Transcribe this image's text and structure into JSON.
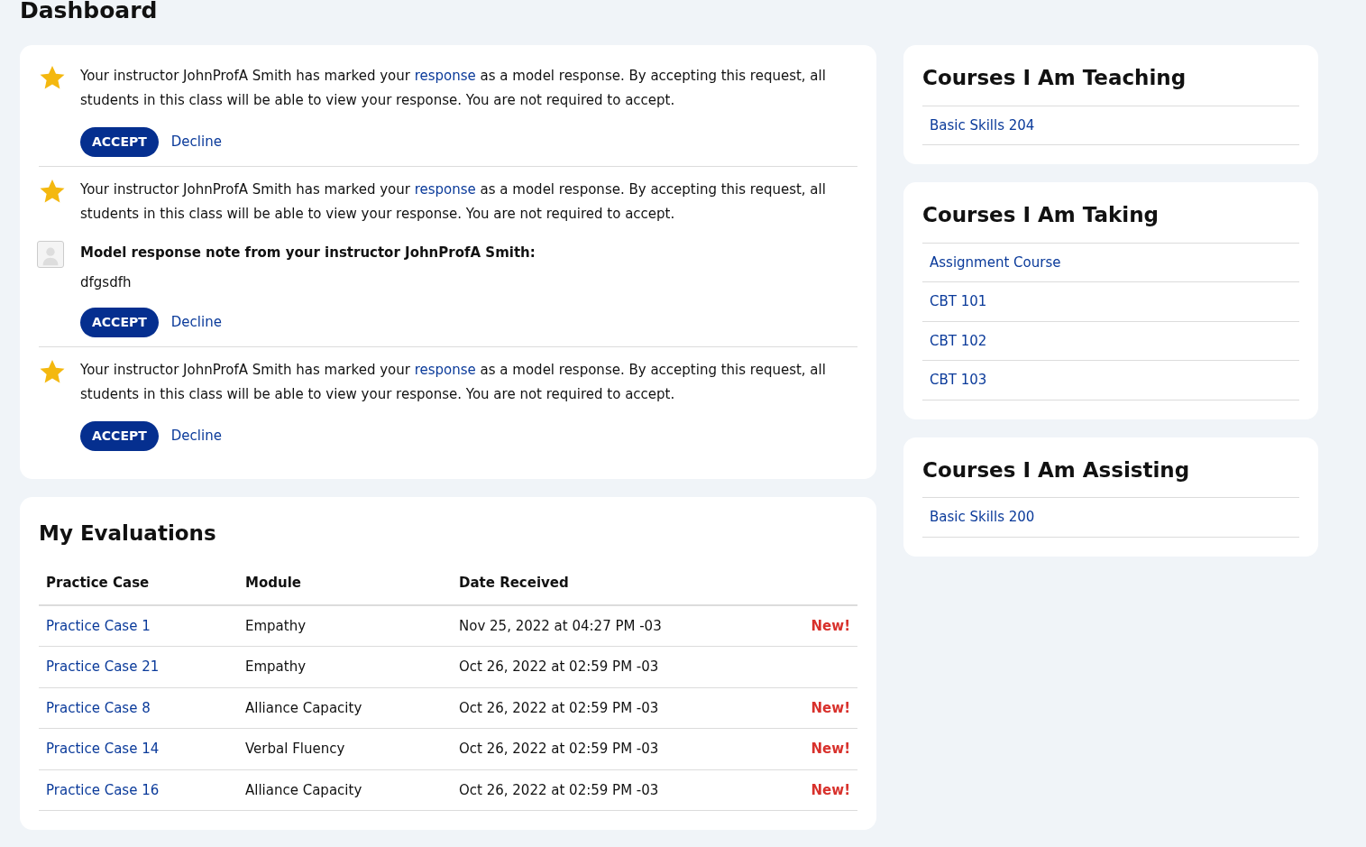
{
  "page_title": "Dashboard",
  "notifications": [
    {
      "text_before": "Your instructor JohnProfA Smith has marked your ",
      "link": "response",
      "text_after": " as a model response. By accepting this request, all students in this class will be able to view your response. You are not required to accept.",
      "accept": "ACCEPT",
      "decline": "Decline"
    },
    {
      "text_before": "Your instructor JohnProfA Smith has marked your ",
      "link": "response",
      "text_after": " as a model response. By accepting this request, all students in this class will be able to view your response. You are not required to accept.",
      "note": {
        "heading": "Model response note from your instructor JohnProfA Smith:",
        "body": "dfgsdfh"
      },
      "accept": "ACCEPT",
      "decline": "Decline"
    },
    {
      "text_before": "Your instructor JohnProfA Smith has marked your ",
      "link": "response",
      "text_after": " as a model response. By accepting this request, all students in this class will be able to view your response. You are not required to accept.",
      "accept": "ACCEPT",
      "decline": "Decline"
    }
  ],
  "evaluations": {
    "title": "My Evaluations",
    "columns": [
      "Practice Case",
      "Module",
      "Date Received"
    ],
    "rows": [
      {
        "case": "Practice Case 1",
        "module": "Empathy",
        "date": "Nov 25, 2022 at 04:27 PM -03",
        "flag": "New!"
      },
      {
        "case": "Practice Case 21",
        "module": "Empathy",
        "date": "Oct 26, 2022 at 02:59 PM -03"
      },
      {
        "case": "Practice Case 8",
        "module": "Alliance Capacity",
        "date": "Oct 26, 2022 at 02:59 PM -03",
        "flag": "New!"
      },
      {
        "case": "Practice Case 14",
        "module": "Verbal Fluency",
        "date": "Oct 26, 2022 at 02:59 PM -03",
        "flag": "New!"
      },
      {
        "case": "Practice Case 16",
        "module": "Alliance Capacity",
        "date": "Oct 26, 2022 at 02:59 PM -03",
        "flag": "New!"
      }
    ]
  },
  "course_panels": [
    {
      "title": "Courses I Am Teaching",
      "courses": [
        "Basic Skills 204"
      ]
    },
    {
      "title": "Courses I Am Taking",
      "courses": [
        "Assignment Course",
        "CBT 101",
        "CBT 102",
        "CBT 103"
      ]
    },
    {
      "title": "Courses I Am Assisting",
      "courses": [
        "Basic Skills 200"
      ]
    }
  ]
}
